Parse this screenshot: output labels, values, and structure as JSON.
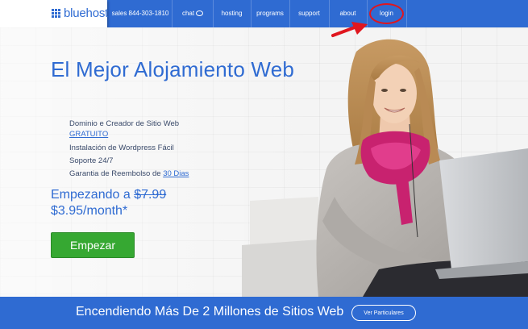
{
  "brand": {
    "name": "bluehost",
    "color": "#2f6bd2"
  },
  "nav": {
    "sales": "sales 844-303-1810",
    "chat": "chat",
    "hosting": "hosting",
    "programs": "programs",
    "support": "support",
    "about": "about",
    "login": "login"
  },
  "hero": {
    "headline": "El Mejor Alojamiento Web",
    "features": {
      "f1": "Dominio e Creador de Sitio Web",
      "f1_link": "GRATUITO",
      "f2": "Instalación de Wordpress Fácil",
      "f3": "Soporte 24/7",
      "f4": "Garantia de Reembolso de ",
      "f4_link": "30 Dias"
    },
    "price_prefix": "Empezando a ",
    "price_old": "$7.99",
    "price_new": "$3.95/month*",
    "cta": "Empezar"
  },
  "footer": {
    "text": "Encendiendo Más De 2 Millones de Sitios Web",
    "button": "Ver Particulares"
  },
  "colors": {
    "nav": "#2f6bd2",
    "cta": "#36a832",
    "annotation": "#e0161e"
  }
}
